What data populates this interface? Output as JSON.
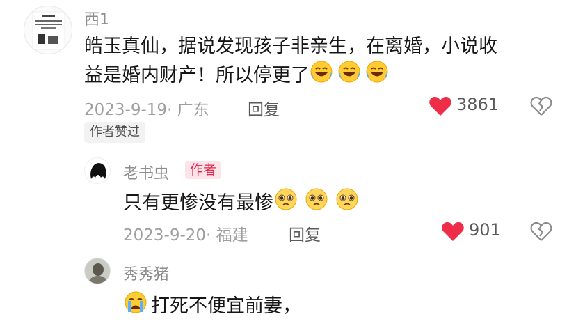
{
  "comments": [
    {
      "username": "西1",
      "avatar": "poster-avatar",
      "text_line1": "皓玉真仙，据说发现孩子非亲生，在离婚，小说收",
      "text_line2": "益是婚内财产！所以停更了",
      "emojis": [
        "laughing-tears-emoji",
        "laughing-tears-emoji",
        "laughing-tears-emoji"
      ],
      "date": "2023-9-19",
      "location": "· 广东",
      "reply_label": "回复",
      "likes": "3861",
      "liked": true,
      "author_liked": "作者赞过"
    },
    {
      "username": "老书虫",
      "avatar": "silhouette-avatar",
      "badge": "作者",
      "text": "只有更惨没有最惨",
      "emojis": [
        "pleading-face-emoji",
        "pleading-face-emoji",
        "pleading-face-emoji"
      ],
      "date": "2023-9-20",
      "location": "· 福建",
      "reply_label": "回复",
      "likes": "901",
      "liked": true
    },
    {
      "username": "秀秀猪",
      "avatar": "photo-avatar",
      "emoji_prefix": "crying-face-emoji",
      "text": "打死不便宜前妻，"
    }
  ],
  "colors": {
    "heart_liked": "#ee2d48",
    "author_badge_bg": "#fde4e8",
    "author_badge_text": "#e4264d"
  }
}
